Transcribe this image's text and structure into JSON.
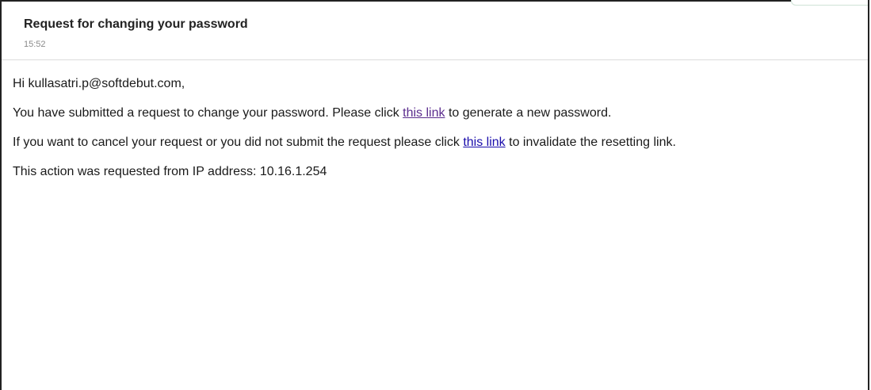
{
  "email": {
    "subject": "Request for changing your password",
    "time": "15:52",
    "greeting": "Hi kullasatri.p@softdebut.com,",
    "paragraph1": {
      "before": "You have submitted a request to change your password. Please click ",
      "link": "this link",
      "after": " to generate a new password."
    },
    "paragraph2": {
      "before": "If you want to cancel your request or you did not submit the request please click ",
      "link": "this link",
      "after": " to invalidate the resetting link."
    },
    "ip_line": "This action was requested from IP address: 10.16.1.254"
  },
  "colors": {
    "visited_link": "#5b2d8e",
    "link": "#1a0dab"
  }
}
